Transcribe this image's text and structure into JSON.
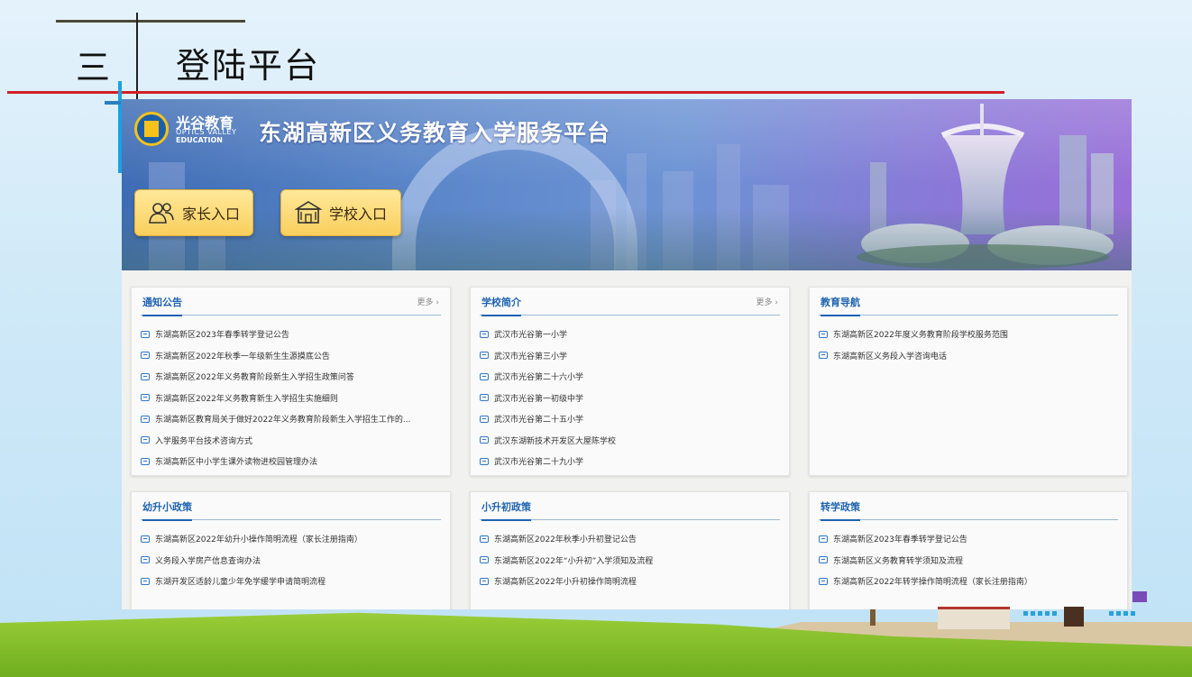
{
  "slide": {
    "number": "三",
    "title": "登陆平台"
  },
  "banner": {
    "brand_cn": "光谷教育",
    "brand_en_1": "OPTICS VALLEY",
    "brand_en_2": "EDUCATION",
    "platform_title": "东湖高新区义务教育入学服务平台",
    "parent_entry": "家长入口",
    "school_entry": "学校入口"
  },
  "cards": {
    "notice": {
      "title": "通知公告",
      "more": "更多 ›",
      "items": [
        "东湖高新区2023年春季转学登记公告",
        "东湖高新区2022年秋季一年级新生生源摸底公告",
        "东湖高新区2022年义务教育阶段新生入学招生政策问答",
        "东湖高新区2022年义务教育新生入学招生实施细则",
        "东湖高新区教育局关于做好2022年义务教育阶段新生入学招生工作的...",
        "入学服务平台技术咨询方式",
        "东湖高新区中小学生课外读物进校园管理办法"
      ]
    },
    "schools": {
      "title": "学校简介",
      "more": "更多 ›",
      "items": [
        "武汉市光谷第一小学",
        "武汉市光谷第三小学",
        "武汉市光谷第二十六小学",
        "武汉市光谷第一初级中学",
        "武汉市光谷第二十五小学",
        "武汉东湖新技术开发区大屋陈学校",
        "武汉市光谷第二十九小学"
      ]
    },
    "guide": {
      "title": "教育导航",
      "items": [
        "东湖高新区2022年度义务教育阶段学校服务范围",
        "东湖高新区义务段入学咨询电话"
      ]
    },
    "kindergarten": {
      "title": "幼升小政策",
      "items": [
        "东湖高新区2022年幼升小操作简明流程（家长注册指南）",
        "义务段入学房产信息查询办法",
        "东湖开发区适龄儿童少年免学缓学申请简明流程"
      ]
    },
    "primary": {
      "title": "小升初政策",
      "items": [
        "东湖高新区2022年秋季小升初登记公告",
        "东湖高新区2022年“小升初”入学须知及流程",
        "东湖高新区2022年小升初操作简明流程"
      ]
    },
    "transfer": {
      "title": "转学政策",
      "items": [
        "东湖高新区2023年春季转学登记公告",
        "东湖高新区义务教育转学须知及流程",
        "东湖高新区2022年转学操作简明流程（家长注册指南）"
      ]
    }
  },
  "colors": {
    "accent_blue": "#1e63b0",
    "heading_red_line": "#d21f26",
    "entry_button": "#f9cf5d"
  },
  "icons": [
    "parents-icon",
    "school-icon",
    "message-bubble-icon",
    "chevron-right-icon"
  ]
}
